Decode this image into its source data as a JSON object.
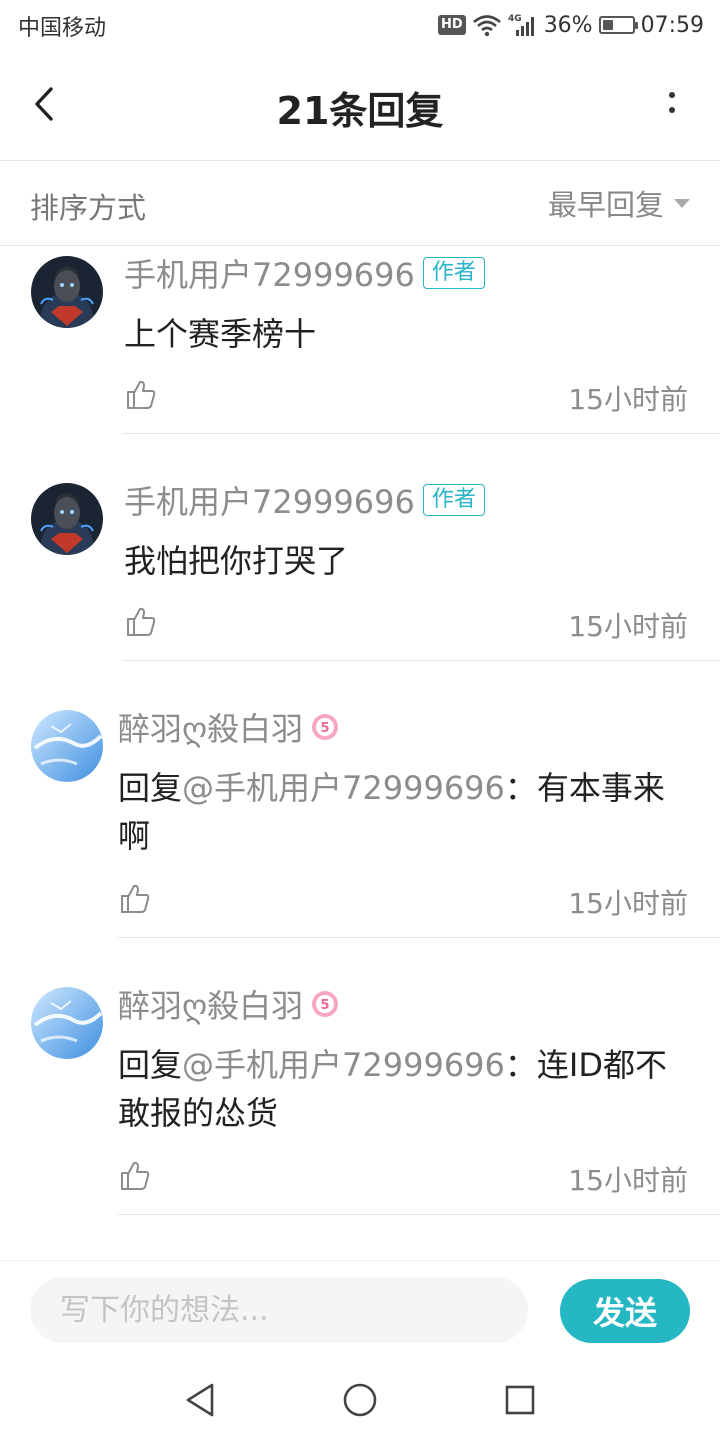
{
  "status_bar": {
    "carrier": "中国移动",
    "hd": "HD",
    "network": "4G",
    "battery": "36%",
    "battery_level": 0.36,
    "time": "07:59"
  },
  "header": {
    "title": "21条回复",
    "back_icon": "chevron-left-icon",
    "more_icon": "more-vertical-icon"
  },
  "sort": {
    "label": "排序方式",
    "selected": "最早回复"
  },
  "comments": [
    {
      "username": "手机用户72999696",
      "tag": "作者",
      "text": "上个赛季榜十",
      "time": "15小时前",
      "avatar": "dark-robot-avatar"
    },
    {
      "username": "手机用户72999696",
      "tag": "作者",
      "text": "我怕把你打哭了",
      "time": "15小时前",
      "avatar": "dark-robot-avatar"
    },
    {
      "username": "醉羽ღ殺白羽",
      "level": "5",
      "reply_prefix": "回复",
      "mention": "@手机用户72999696",
      "separator": "：",
      "text": "有本事来啊",
      "time": "15小时前",
      "avatar": "sky-avatar"
    },
    {
      "username": "醉羽ღ殺白羽",
      "level": "5",
      "reply_prefix": "回复",
      "mention": "@手机用户72999696",
      "separator": "：",
      "text": "连ID都不敢报的怂货",
      "time": "15小时前",
      "avatar": "sky-avatar"
    }
  ],
  "input": {
    "placeholder": "写下你的想法...",
    "send_label": "发送"
  },
  "colors": {
    "accent": "#25b7c3",
    "tag": "#27b4c7",
    "muted_text": "#8c8c8c"
  }
}
